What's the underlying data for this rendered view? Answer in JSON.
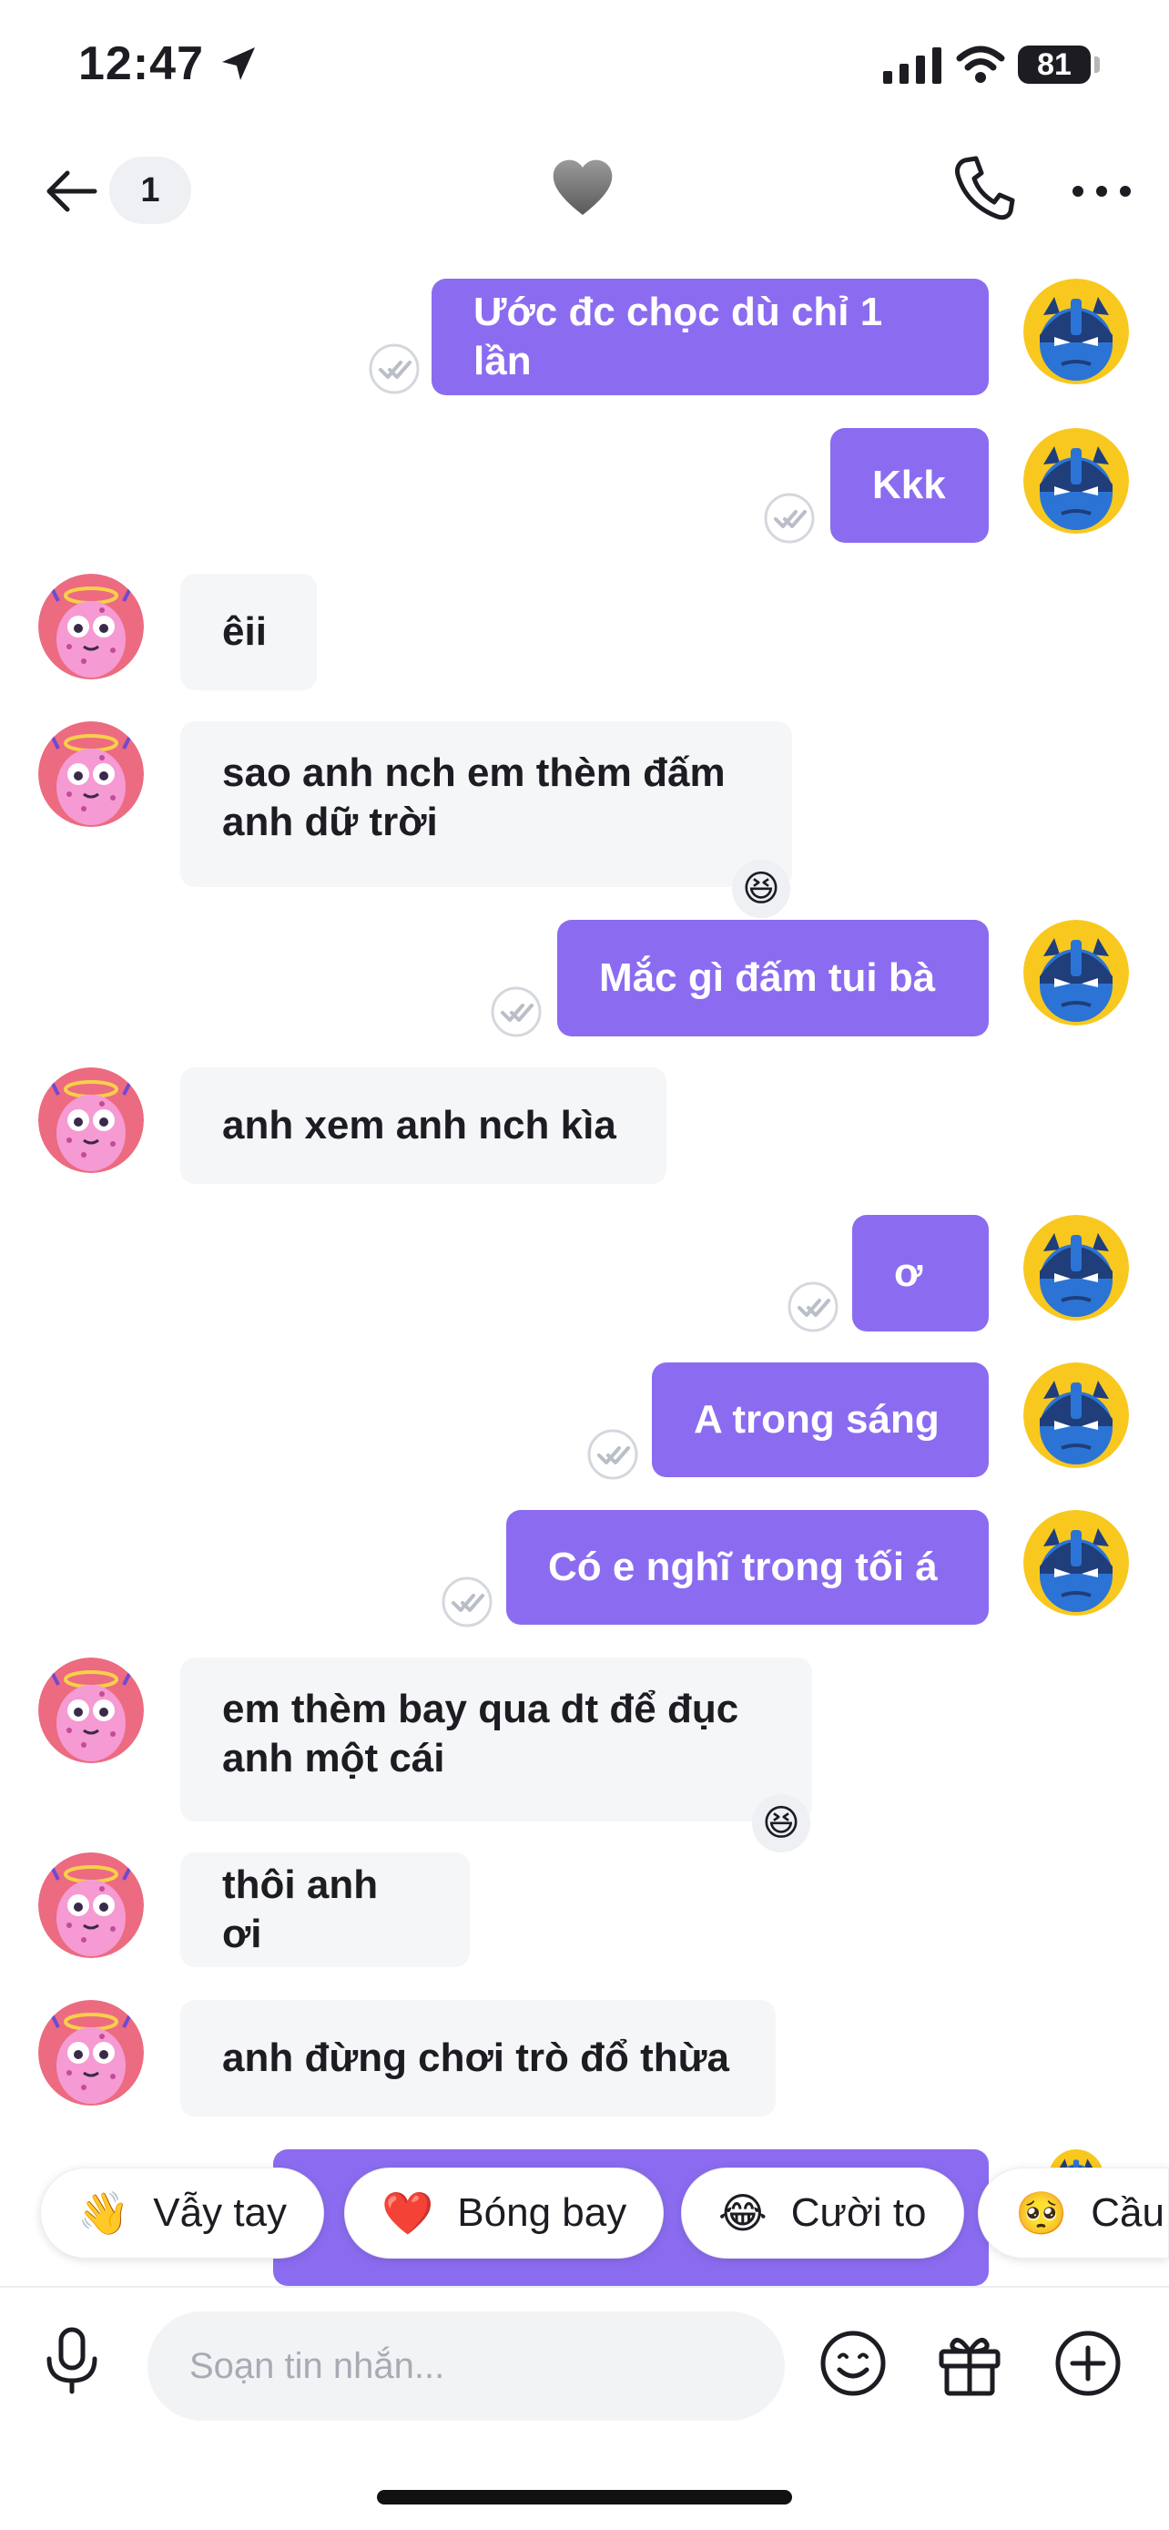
{
  "status_bar": {
    "time": "12:47",
    "battery": "81"
  },
  "header": {
    "unread_count": "1",
    "title_icon": "heart"
  },
  "messages": [
    {
      "side": "out",
      "text": "Ước đc chọc dù chỉ 1 lần"
    },
    {
      "side": "out",
      "text": "Kkk"
    },
    {
      "side": "in",
      "text": "êii"
    },
    {
      "side": "in",
      "text": "sao anh nch em thèm đấm anh dữ trời",
      "reaction": "😆"
    },
    {
      "side": "out",
      "text": "Mắc gì đấm tui bà"
    },
    {
      "side": "in",
      "text": "anh xem anh nch kìa"
    },
    {
      "side": "out",
      "text": "ơ"
    },
    {
      "side": "out",
      "text": "A trong sáng"
    },
    {
      "side": "out",
      "text": "Có e nghĩ trong tối á"
    },
    {
      "side": "in",
      "text": "em thèm bay qua dt để đục anh một cái",
      "reaction": "😆"
    },
    {
      "side": "in",
      "text": "thôi anh ơi"
    },
    {
      "side": "in",
      "text": "anh đừng chơi trò đổ thừa"
    }
  ],
  "quick_reactions": [
    {
      "emoji": "👋",
      "label": "Vẫy tay"
    },
    {
      "emoji": "❤️",
      "label": "Bóng bay"
    },
    {
      "emoji": "😂",
      "label": "Cười to"
    },
    {
      "emoji": "🥺",
      "label": "Cầu"
    }
  ],
  "composer": {
    "placeholder": "Soạn tin nhắn..."
  },
  "colors": {
    "accent": "#8b6cf0",
    "incoming_bubble": "#f5f6f8"
  }
}
